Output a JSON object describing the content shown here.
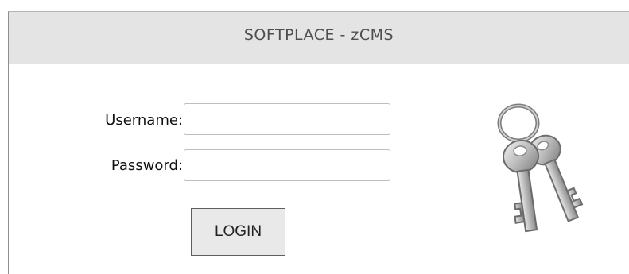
{
  "header": {
    "title": "SOFTPLACE - zCMS"
  },
  "form": {
    "username_label": "Username:",
    "username_value": "",
    "password_label": "Password:",
    "password_value": "",
    "login_label": "LOGIN"
  },
  "icons": {
    "keys": "keys-icon"
  }
}
